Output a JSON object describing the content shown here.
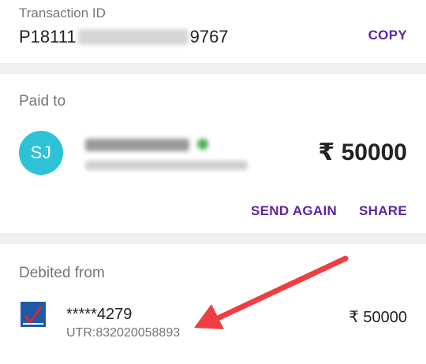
{
  "transaction": {
    "label": "Transaction ID",
    "id_prefix": "P18111",
    "id_suffix": "9767",
    "copy_label": "COPY"
  },
  "paid_to": {
    "label": "Paid to",
    "initials": "SJ",
    "amount": "₹ 50000",
    "send_again_label": "SEND AGAIN",
    "share_label": "SHARE"
  },
  "debited_from": {
    "label": "Debited from",
    "account": "*****4279",
    "utr": "UTR:832020058893",
    "amount": "₹ 50000"
  },
  "colors": {
    "accent": "#5f259f",
    "avatar": "#2dc2d8",
    "annotation_arrow": "#ef3e42",
    "bank_logo": "#1e5aa8"
  }
}
